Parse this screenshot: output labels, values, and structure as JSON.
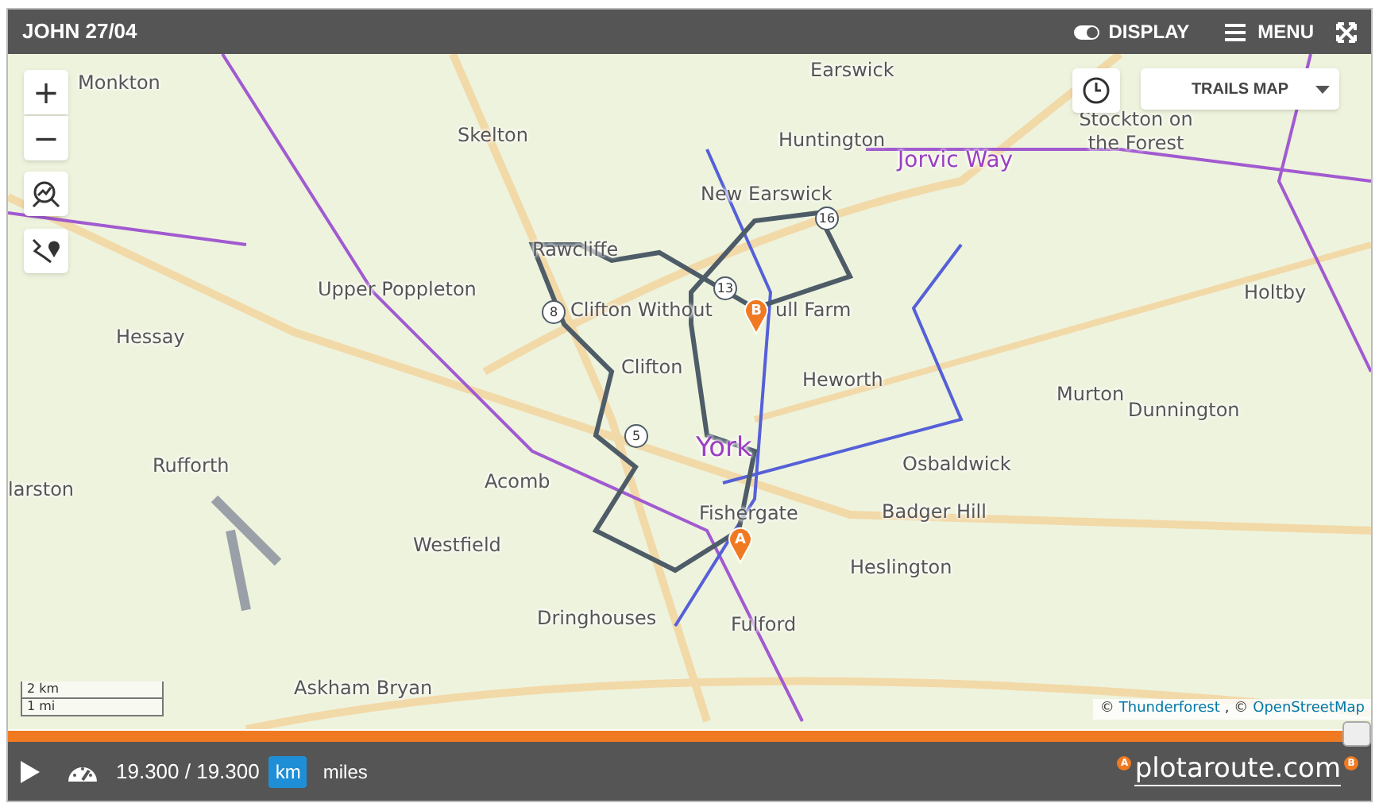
{
  "top_bar": {
    "title": "JOHN 27/04",
    "display_toggle": {
      "label": "DISPLAY",
      "on": true
    },
    "menu": {
      "label": "MENU"
    }
  },
  "map": {
    "zoom_in": "+",
    "zoom_out": "−",
    "layer_select": {
      "value": "TRAILS MAP"
    },
    "places": [
      {
        "name": "Monkton",
        "kind": "town"
      },
      {
        "name": "Earswick",
        "kind": "town"
      },
      {
        "name": "Skelton",
        "kind": "town"
      },
      {
        "name": "Huntington",
        "kind": "town"
      },
      {
        "name": "Stockton on the Forest",
        "kind": "town"
      },
      {
        "name": "Jorvic Way",
        "kind": "trail"
      },
      {
        "name": "New Earswick",
        "kind": "town"
      },
      {
        "name": "Rawcliffe",
        "kind": "town"
      },
      {
        "name": "Upper Poppleton",
        "kind": "town"
      },
      {
        "name": "Clifton Without",
        "kind": "town"
      },
      {
        "name": "ull Farm",
        "kind": "town"
      },
      {
        "name": "Holtby",
        "kind": "town"
      },
      {
        "name": "Hessay",
        "kind": "town"
      },
      {
        "name": "Clifton",
        "kind": "town"
      },
      {
        "name": "Heworth",
        "kind": "town"
      },
      {
        "name": "Murton",
        "kind": "town"
      },
      {
        "name": "Dunnington",
        "kind": "town"
      },
      {
        "name": "York",
        "kind": "city"
      },
      {
        "name": "Osbaldwick",
        "kind": "town"
      },
      {
        "name": "Rufforth",
        "kind": "town"
      },
      {
        "name": "larston",
        "kind": "town"
      },
      {
        "name": "Acomb",
        "kind": "town"
      },
      {
        "name": "Fishergate",
        "kind": "town"
      },
      {
        "name": "Badger Hill",
        "kind": "town"
      },
      {
        "name": "Heslington",
        "kind": "town"
      },
      {
        "name": "Westfield",
        "kind": "town"
      },
      {
        "name": "Dringhouses",
        "kind": "town"
      },
      {
        "name": "Fulford",
        "kind": "town"
      },
      {
        "name": "Askham Bryan",
        "kind": "town"
      }
    ],
    "distance_markers": [
      "16",
      "13",
      "8",
      "5"
    ],
    "pins": [
      {
        "label": "A"
      },
      {
        "label": "B"
      }
    ],
    "scale": {
      "metric": "2 km",
      "imperial": "1 mi"
    },
    "attribution": {
      "prefix": "©",
      "link_1": "Thunderforest",
      "separator": ", ©",
      "link_2": "OpenStreetMap"
    }
  },
  "progress": {
    "level": 1
  },
  "bottom_bar": {
    "distance": "19.300 / 19.300",
    "units": [
      {
        "label": "km",
        "selected": true
      },
      {
        "label": "miles",
        "selected": false
      }
    ],
    "logo": {
      "text": "plotaroute.com",
      "start": "A",
      "end": "B"
    }
  }
}
